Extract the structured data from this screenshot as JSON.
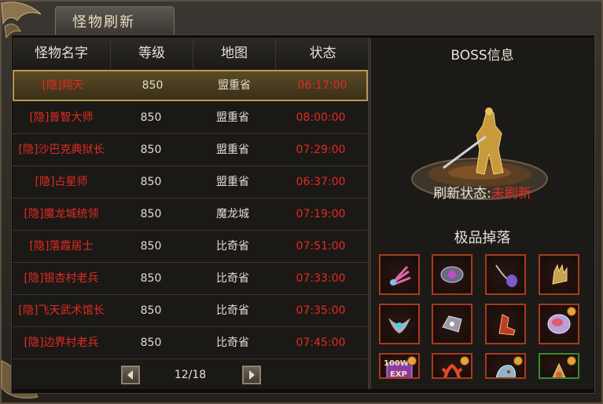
{
  "window": {
    "title": "怪物刷新"
  },
  "table": {
    "headers": {
      "name": "怪物名字",
      "level": "等级",
      "map": "地图",
      "status": "状态"
    },
    "rows": [
      {
        "name": "[隐]翔天",
        "level": "850",
        "map": "盟重省",
        "time": "06:17:00",
        "selected": true
      },
      {
        "name": "[隐]普智大师",
        "level": "850",
        "map": "盟重省",
        "time": "08:00:00",
        "selected": false
      },
      {
        "name": "[隐]沙巴克典狱长",
        "level": "850",
        "map": "盟重省",
        "time": "07:29:00",
        "selected": false
      },
      {
        "name": "[隐]占星师",
        "level": "850",
        "map": "盟重省",
        "time": "06:37:00",
        "selected": false
      },
      {
        "name": "[隐]魔龙城统领",
        "level": "850",
        "map": "魔龙城",
        "time": "07:19:00",
        "selected": false
      },
      {
        "name": "[隐]落霞居士",
        "level": "850",
        "map": "比奇省",
        "time": "07:51:00",
        "selected": false
      },
      {
        "name": "[隐]银杏村老兵",
        "level": "850",
        "map": "比奇省",
        "time": "07:33:00",
        "selected": false
      },
      {
        "name": "[隐]飞天武术馆长",
        "level": "850",
        "map": "比奇省",
        "time": "07:35:00",
        "selected": false
      },
      {
        "name": "[隐]边界村老兵",
        "level": "850",
        "map": "比奇省",
        "time": "07:45:00",
        "selected": false
      }
    ]
  },
  "pager": {
    "text": "12/18",
    "prev_icon": "arrow-left-icon",
    "next_icon": "arrow-right-icon"
  },
  "boss": {
    "title": "BOSS信息",
    "status_label": "刷新状态:",
    "status_value": "未刷新",
    "drops_title": "极品掉落",
    "drops": [
      {
        "icon": "feather-fan-icon"
      },
      {
        "icon": "gem-bracelet-icon"
      },
      {
        "icon": "amulet-necklace-icon"
      },
      {
        "icon": "golden-glove-icon"
      },
      {
        "icon": "wing-helmet-icon"
      },
      {
        "icon": "silver-bracer-icon"
      },
      {
        "icon": "flame-boot-icon"
      },
      {
        "icon": "crystal-orb-icon"
      },
      {
        "icon": "exp-scroll-icon",
        "label1": "100W",
        "label2": "EXP"
      },
      {
        "icon": "red-coral-icon"
      },
      {
        "icon": "beast-head-icon"
      },
      {
        "icon": "golden-ornament-icon"
      }
    ]
  },
  "colors": {
    "red_text": "#e22b22",
    "gold_border": "#b89a52",
    "slot_border": "#a83a1e",
    "slot_green": "#3c8a2c"
  }
}
